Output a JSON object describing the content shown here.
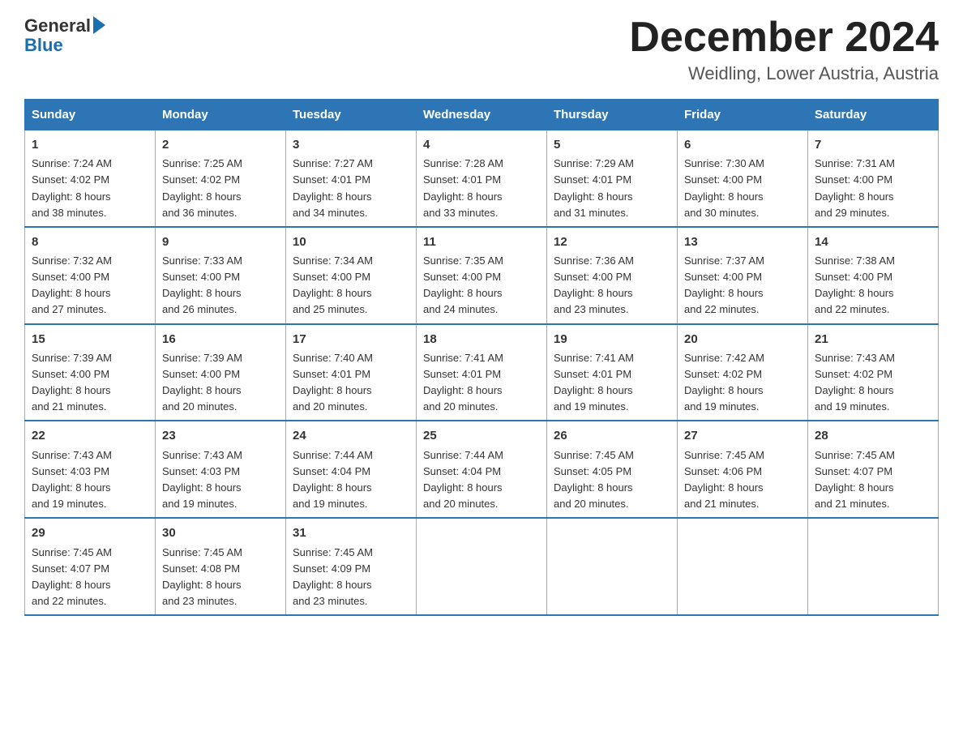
{
  "header": {
    "logo_line1": "General",
    "logo_line2": "Blue",
    "month_title": "December 2024",
    "location": "Weidling, Lower Austria, Austria"
  },
  "days_of_week": [
    "Sunday",
    "Monday",
    "Tuesday",
    "Wednesday",
    "Thursday",
    "Friday",
    "Saturday"
  ],
  "weeks": [
    [
      {
        "day": "1",
        "sunrise": "7:24 AM",
        "sunset": "4:02 PM",
        "daylight": "8 hours and 38 minutes."
      },
      {
        "day": "2",
        "sunrise": "7:25 AM",
        "sunset": "4:02 PM",
        "daylight": "8 hours and 36 minutes."
      },
      {
        "day": "3",
        "sunrise": "7:27 AM",
        "sunset": "4:01 PM",
        "daylight": "8 hours and 34 minutes."
      },
      {
        "day": "4",
        "sunrise": "7:28 AM",
        "sunset": "4:01 PM",
        "daylight": "8 hours and 33 minutes."
      },
      {
        "day": "5",
        "sunrise": "7:29 AM",
        "sunset": "4:01 PM",
        "daylight": "8 hours and 31 minutes."
      },
      {
        "day": "6",
        "sunrise": "7:30 AM",
        "sunset": "4:00 PM",
        "daylight": "8 hours and 30 minutes."
      },
      {
        "day": "7",
        "sunrise": "7:31 AM",
        "sunset": "4:00 PM",
        "daylight": "8 hours and 29 minutes."
      }
    ],
    [
      {
        "day": "8",
        "sunrise": "7:32 AM",
        "sunset": "4:00 PM",
        "daylight": "8 hours and 27 minutes."
      },
      {
        "day": "9",
        "sunrise": "7:33 AM",
        "sunset": "4:00 PM",
        "daylight": "8 hours and 26 minutes."
      },
      {
        "day": "10",
        "sunrise": "7:34 AM",
        "sunset": "4:00 PM",
        "daylight": "8 hours and 25 minutes."
      },
      {
        "day": "11",
        "sunrise": "7:35 AM",
        "sunset": "4:00 PM",
        "daylight": "8 hours and 24 minutes."
      },
      {
        "day": "12",
        "sunrise": "7:36 AM",
        "sunset": "4:00 PM",
        "daylight": "8 hours and 23 minutes."
      },
      {
        "day": "13",
        "sunrise": "7:37 AM",
        "sunset": "4:00 PM",
        "daylight": "8 hours and 22 minutes."
      },
      {
        "day": "14",
        "sunrise": "7:38 AM",
        "sunset": "4:00 PM",
        "daylight": "8 hours and 22 minutes."
      }
    ],
    [
      {
        "day": "15",
        "sunrise": "7:39 AM",
        "sunset": "4:00 PM",
        "daylight": "8 hours and 21 minutes."
      },
      {
        "day": "16",
        "sunrise": "7:39 AM",
        "sunset": "4:00 PM",
        "daylight": "8 hours and 20 minutes."
      },
      {
        "day": "17",
        "sunrise": "7:40 AM",
        "sunset": "4:01 PM",
        "daylight": "8 hours and 20 minutes."
      },
      {
        "day": "18",
        "sunrise": "7:41 AM",
        "sunset": "4:01 PM",
        "daylight": "8 hours and 20 minutes."
      },
      {
        "day": "19",
        "sunrise": "7:41 AM",
        "sunset": "4:01 PM",
        "daylight": "8 hours and 19 minutes."
      },
      {
        "day": "20",
        "sunrise": "7:42 AM",
        "sunset": "4:02 PM",
        "daylight": "8 hours and 19 minutes."
      },
      {
        "day": "21",
        "sunrise": "7:43 AM",
        "sunset": "4:02 PM",
        "daylight": "8 hours and 19 minutes."
      }
    ],
    [
      {
        "day": "22",
        "sunrise": "7:43 AM",
        "sunset": "4:03 PM",
        "daylight": "8 hours and 19 minutes."
      },
      {
        "day": "23",
        "sunrise": "7:43 AM",
        "sunset": "4:03 PM",
        "daylight": "8 hours and 19 minutes."
      },
      {
        "day": "24",
        "sunrise": "7:44 AM",
        "sunset": "4:04 PM",
        "daylight": "8 hours and 19 minutes."
      },
      {
        "day": "25",
        "sunrise": "7:44 AM",
        "sunset": "4:04 PM",
        "daylight": "8 hours and 20 minutes."
      },
      {
        "day": "26",
        "sunrise": "7:45 AM",
        "sunset": "4:05 PM",
        "daylight": "8 hours and 20 minutes."
      },
      {
        "day": "27",
        "sunrise": "7:45 AM",
        "sunset": "4:06 PM",
        "daylight": "8 hours and 21 minutes."
      },
      {
        "day": "28",
        "sunrise": "7:45 AM",
        "sunset": "4:07 PM",
        "daylight": "8 hours and 21 minutes."
      }
    ],
    [
      {
        "day": "29",
        "sunrise": "7:45 AM",
        "sunset": "4:07 PM",
        "daylight": "8 hours and 22 minutes."
      },
      {
        "day": "30",
        "sunrise": "7:45 AM",
        "sunset": "4:08 PM",
        "daylight": "8 hours and 23 minutes."
      },
      {
        "day": "31",
        "sunrise": "7:45 AM",
        "sunset": "4:09 PM",
        "daylight": "8 hours and 23 minutes."
      },
      null,
      null,
      null,
      null
    ]
  ],
  "labels": {
    "sunrise": "Sunrise:",
    "sunset": "Sunset:",
    "daylight": "Daylight:"
  }
}
